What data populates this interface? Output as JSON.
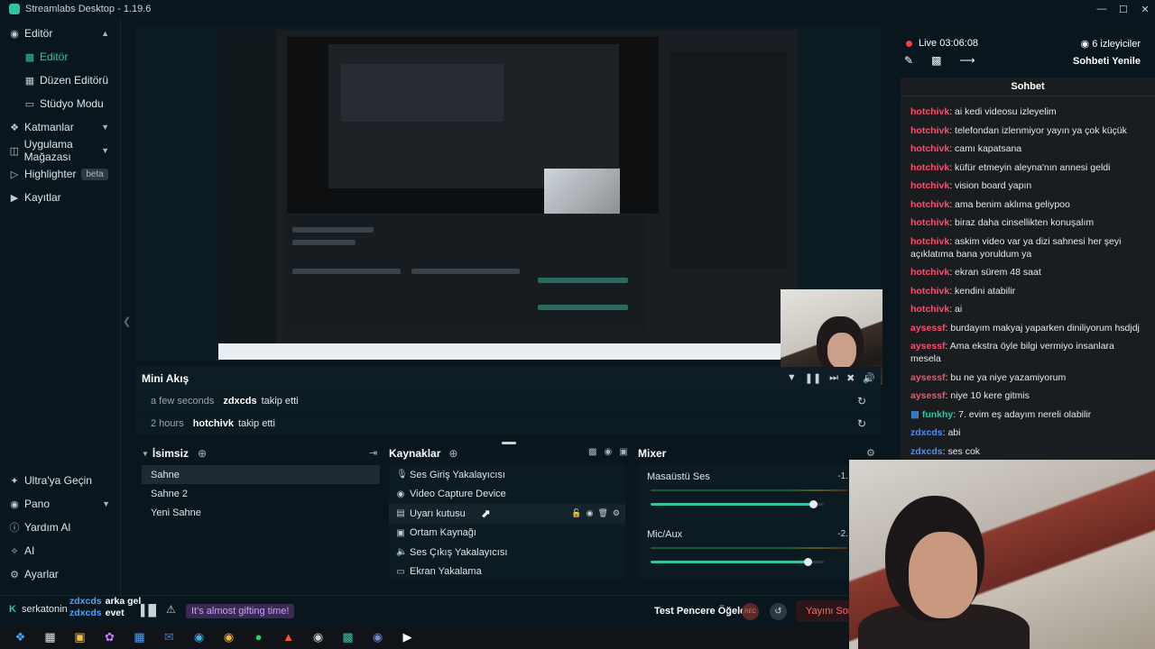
{
  "titlebar": {
    "title": "Streamlabs Desktop - 1.19.6"
  },
  "sidebar": {
    "items": [
      {
        "label": "Editör"
      },
      {
        "label": "Editör"
      },
      {
        "label": "Düzen Editörü"
      },
      {
        "label": "Stüdyo Modu"
      },
      {
        "label": "Katmanlar"
      },
      {
        "label": "Uygulama Mağazası"
      },
      {
        "label": "Highlighter",
        "badge": "beta"
      },
      {
        "label": "Kayıtlar"
      }
    ],
    "bottom": [
      {
        "label": "Ultra'ya Geçin"
      },
      {
        "label": "Pano"
      },
      {
        "label": "Yardım Al"
      },
      {
        "label": "AI"
      },
      {
        "label": "Ayarlar"
      }
    ]
  },
  "mini_feed": {
    "title": "Mini Akış",
    "rows": [
      {
        "time": "a few seconds",
        "user": "zdxcds",
        "action": "takip etti"
      },
      {
        "time": "2 hours",
        "user": "hotchivk",
        "action": "takip etti"
      }
    ]
  },
  "scenes": {
    "title": "İsimsiz",
    "items": [
      "Sahne",
      "Sahne 2",
      "Yeni Sahne"
    ]
  },
  "sources": {
    "title": "Kaynaklar",
    "items": [
      {
        "label": "Ses Giriş Yakalayıcısı",
        "icon": "microphone-icon"
      },
      {
        "label": "Video Capture Device",
        "icon": "camera-icon"
      },
      {
        "label": "Uyarı kutusu",
        "icon": "alert-box-icon"
      },
      {
        "label": "Ortam Kaynağı",
        "icon": "media-icon"
      },
      {
        "label": "Ses Çıkış Yakalayıcısı",
        "icon": "speaker-icon"
      },
      {
        "label": "Ekran Yakalama",
        "icon": "monitor-icon"
      }
    ]
  },
  "mixer": {
    "title": "Mixer",
    "channels": [
      {
        "label": "Masaüstü Ses",
        "db": "-1.",
        "level": 0.94
      },
      {
        "label": "Mic/Aux",
        "db": "-2.",
        "level": 0.91
      }
    ]
  },
  "statusbar": {
    "username": "serkatonin",
    "chat_names": [
      "zdxcds",
      "zdxcds"
    ],
    "chat_msgs": [
      "arka gel",
      "evet"
    ],
    "gift_text": "It's almost gifting time!",
    "test_windows": "Test Pencere Öğeleri",
    "rec_label": "REC",
    "go_live": "Yayını Sonl"
  },
  "chat": {
    "live_label": "Live 03:06:08",
    "viewers": "6 izleyiciler",
    "refresh": "Sohbeti Yenile",
    "title": "Sohbet",
    "messages": [
      {
        "user": "hotchivk",
        "text": ": ai kedi videosu izleyelim",
        "color": "#ff4d6d"
      },
      {
        "user": "hotchivk",
        "text": ": telefondan izlenmiyor yayın ya çok küçük",
        "color": "#ff4d6d"
      },
      {
        "user": "hotchivk",
        "text": ": camı kapatsana",
        "color": "#ff4d6d"
      },
      {
        "user": "hotchivk",
        "text": ": küfür etmeyin aleyna'nın annesi geldi",
        "color": "#ff4d6d"
      },
      {
        "user": "hotchivk",
        "text": ": vision board yapın",
        "color": "#ff4d6d"
      },
      {
        "user": "hotchivk",
        "text": ": ama benim aklıma geliypoo",
        "color": "#ff4d6d"
      },
      {
        "user": "hotchivk",
        "text": ": biraz daha cinsellikten konuşalım",
        "color": "#ff4d6d"
      },
      {
        "user": "hotchivk",
        "text": ": askim video var ya dizi sahnesi her şeyi açıklatıma bana yoruldum ya",
        "color": "#ff4d6d"
      },
      {
        "user": "hotchivk",
        "text": ": ekran sürem 48 saat",
        "color": "#ff4d6d"
      },
      {
        "user": "hotchivk",
        "text": ": kendini atabilir",
        "color": "#ff4d6d"
      },
      {
        "user": "hotchivk",
        "text": ": ai",
        "color": "#ff4d6d"
      },
      {
        "user": "aysessf",
        "text": ": burdayım makyaj yaparken diniliyorum hsdjdj",
        "color": "#ff4d6d"
      },
      {
        "user": "aysessf",
        "text": ": Ama ekstra öyle bilgi vermiyo insanlara mesela",
        "color": "#ff4d6d"
      },
      {
        "user": "aysessf",
        "text": ": bu ne ya niye yazamiyorum",
        "color": "#ff4d6d"
      },
      {
        "user": "aysessf",
        "text": ": niye 10 kere gitmis",
        "color": "#ff4d6d"
      },
      {
        "user": "funkhy",
        "text": ": 7. evim eş adayım nereli olabilir",
        "color": "#31c3a2"
      },
      {
        "user": "zdxcds",
        "text": ": abi",
        "color": "#4a8cff"
      },
      {
        "user": "zdxcds",
        "text": ": ses cok",
        "color": "#4a8cff"
      }
    ]
  },
  "taskbar": {
    "icons": [
      "windows-start-icon",
      "task-view-icon",
      "file-explorer-icon",
      "copilot-icon",
      "calculator-icon",
      "outlook-icon",
      "edge-icon",
      "chrome-icon",
      "spotify-icon",
      "brave-icon",
      "steam-icon",
      "streamlabs-icon",
      "discord-icon",
      "media-player-icon"
    ]
  }
}
